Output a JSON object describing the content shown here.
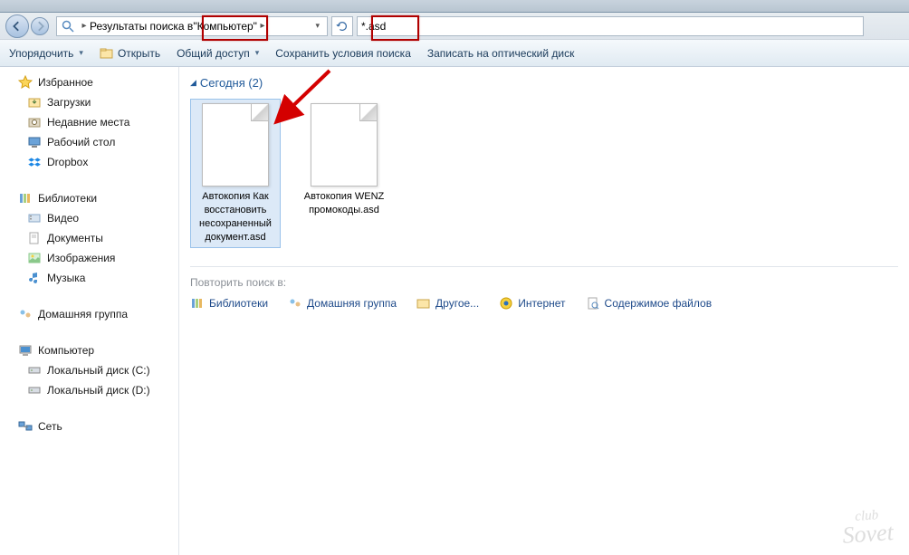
{
  "breadcrumb": {
    "prefix": "Результаты поиска в ",
    "location": "\"Компьютер\""
  },
  "search": {
    "value": "*.asd"
  },
  "toolbar": {
    "organize": "Упорядочить",
    "open": "Открыть",
    "share": "Общий доступ",
    "save_search": "Сохранить условия поиска",
    "burn": "Записать на оптический диск"
  },
  "sidebar": {
    "favorites": {
      "label": "Избранное",
      "items": [
        {
          "id": "downloads",
          "label": "Загрузки",
          "icon": "folder-down"
        },
        {
          "id": "recent",
          "label": "Недавние места",
          "icon": "recent"
        },
        {
          "id": "desktop",
          "label": "Рабочий стол",
          "icon": "desktop"
        },
        {
          "id": "dropbox",
          "label": "Dropbox",
          "icon": "dropbox"
        }
      ]
    },
    "libraries": {
      "label": "Библиотеки",
      "items": [
        {
          "id": "videos",
          "label": "Видео",
          "icon": "video"
        },
        {
          "id": "documents",
          "label": "Документы",
          "icon": "doc"
        },
        {
          "id": "pictures",
          "label": "Изображения",
          "icon": "pic"
        },
        {
          "id": "music",
          "label": "Музыка",
          "icon": "music"
        }
      ]
    },
    "homegroup": {
      "label": "Домашняя группа"
    },
    "computer": {
      "label": "Компьютер",
      "items": [
        {
          "id": "disk-c",
          "label": "Локальный диск (C:)",
          "icon": "hdd"
        },
        {
          "id": "disk-d",
          "label": "Локальный диск (D:)",
          "icon": "hdd"
        }
      ]
    },
    "network": {
      "label": "Сеть"
    }
  },
  "group_header": "Сегодня (2)",
  "files": [
    {
      "name": "Автокопия Как восстановить несохраненный документ.asd",
      "selected": true
    },
    {
      "name": "Автокопия WENZ промокоды.asd",
      "selected": false
    }
  ],
  "repeat_search": {
    "label": "Повторить поиск в:",
    "options": [
      {
        "id": "libraries",
        "label": "Библиотеки",
        "icon": "lib"
      },
      {
        "id": "homegroup",
        "label": "Домашняя группа",
        "icon": "hg"
      },
      {
        "id": "other",
        "label": "Другое...",
        "icon": "other"
      },
      {
        "id": "internet",
        "label": "Интернет",
        "icon": "ie"
      },
      {
        "id": "filecontents",
        "label": "Содержимое файлов",
        "icon": "fc"
      }
    ]
  },
  "watermark": {
    "top": "club",
    "bottom": "Sovet"
  }
}
